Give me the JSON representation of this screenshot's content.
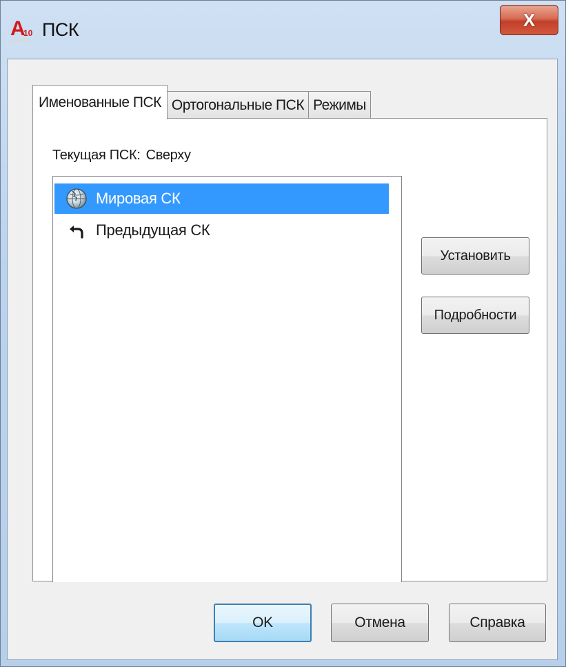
{
  "window": {
    "title": "ПСК",
    "app_icon_letter": "A",
    "app_icon_version": "10",
    "close_label": "X"
  },
  "tabs": [
    {
      "label": "Именованные ПСК",
      "active": true
    },
    {
      "label": "Ортогональные ПСК",
      "active": false
    },
    {
      "label": "Режимы",
      "active": false
    }
  ],
  "panel": {
    "current_label": "Текущая ПСК:",
    "current_value": "Сверху",
    "list_items": [
      {
        "label": "Мировая СК",
        "icon": "globe-icon",
        "selected": true
      },
      {
        "label": "Предыдущая СК",
        "icon": "undo-arrow-icon",
        "selected": false
      }
    ],
    "set_button": "Установить",
    "details_button": "Подробности"
  },
  "footer": {
    "ok_label": "OK",
    "cancel_label": "Отмена",
    "help_label": "Справка"
  },
  "colors": {
    "selection": "#3399ff",
    "title_bar": "#bcd3ee",
    "close_button": "#c2402a",
    "default_button_border": "#3c7fb1"
  }
}
